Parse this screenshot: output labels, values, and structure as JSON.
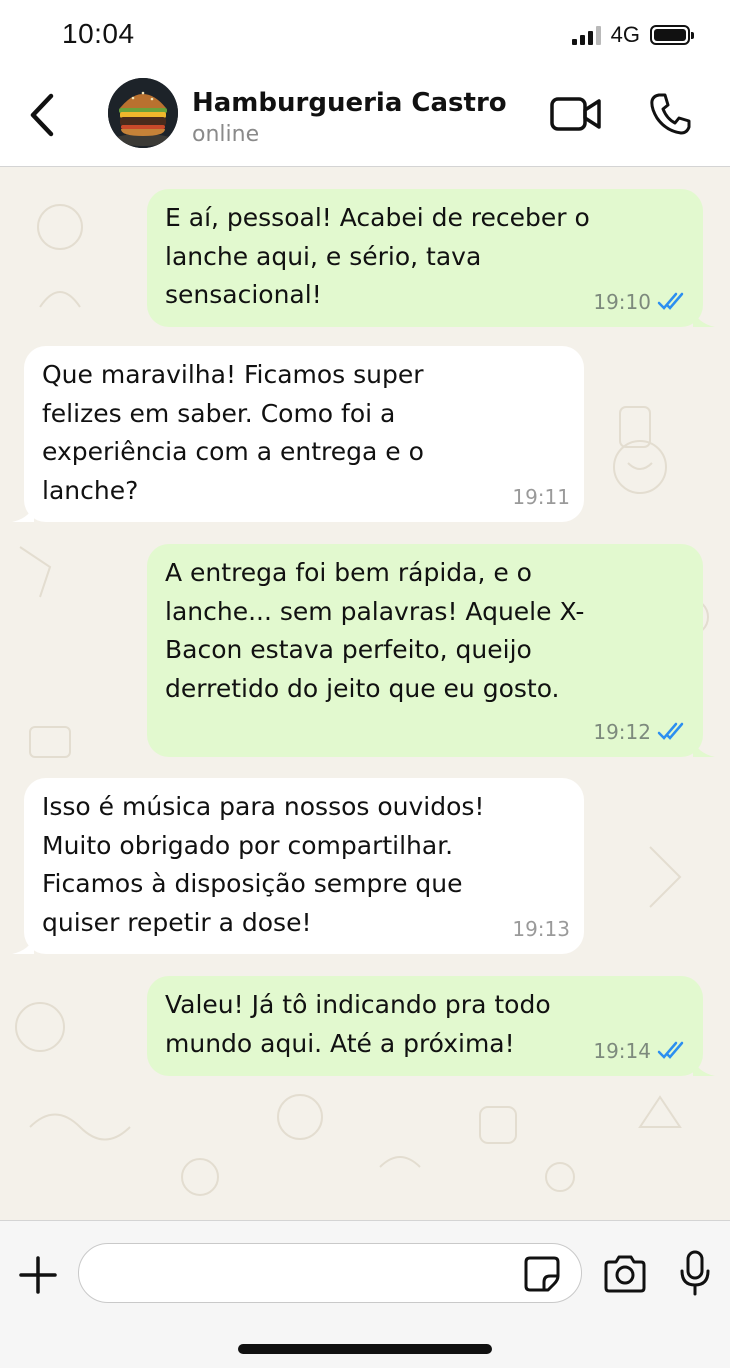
{
  "status_bar": {
    "time": "10:04",
    "network": "4G"
  },
  "header": {
    "contact_name": "Hamburgueria Castro",
    "contact_status": "online",
    "icons": [
      "back-chevron-icon",
      "video-call-icon",
      "phone-icon"
    ]
  },
  "messages": [
    {
      "direction": "outgoing",
      "text": "E aí, pessoal! Acabei de receber o\nlanche aqui, e sério, tava\nsensacional!",
      "time": "19:10",
      "read": true
    },
    {
      "direction": "incoming",
      "text": "Que maravilha! Ficamos super\nfelizes em saber. Como foi a\nexperiência com a entrega e o\nlanche?",
      "time": "19:11"
    },
    {
      "direction": "outgoing",
      "text": "A entrega foi bem rápida, e o\nlanche... sem palavras! Aquele X-\nBacon estava perfeito, queijo\nderretido do jeito que eu gosto.",
      "time": "19:12",
      "read": true
    },
    {
      "direction": "incoming",
      "text": "Isso é música para nossos ouvidos!\nMuito obrigado por compartilhar.\nFicamos à disposição sempre que\nquiser repetir a dose!",
      "time": "19:13"
    },
    {
      "direction": "outgoing",
      "text": "Valeu! Já tô indicando pra todo\nmundo aqui. Até a próxima!",
      "time": "19:14",
      "read": true
    }
  ],
  "colors": {
    "outgoing_bubble": "#e2f9cf",
    "incoming_bubble": "#ffffff",
    "chat_background": "#f4f1ea",
    "read_ticks": "#2c8ff0"
  },
  "input_bar": {
    "placeholder": "",
    "icons": [
      "plus-icon",
      "sticker-icon",
      "camera-icon",
      "microphone-icon"
    ]
  }
}
